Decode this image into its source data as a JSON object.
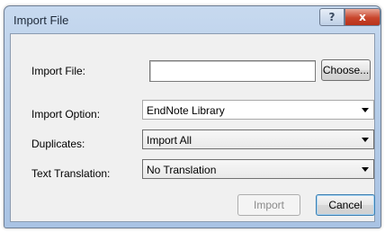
{
  "window": {
    "title": "Import File",
    "help_label": "?",
    "close_label": "x"
  },
  "form": {
    "import_file": {
      "label": "Import File:",
      "value": "",
      "choose_label": "Choose..."
    },
    "import_option": {
      "label": "Import Option:",
      "value": "EndNote Library"
    },
    "duplicates": {
      "label": "Duplicates:",
      "value": "Import All"
    },
    "text_translation": {
      "label": "Text Translation:",
      "value": "No Translation"
    }
  },
  "buttons": {
    "import_label": "Import",
    "import_enabled": false,
    "cancel_label": "Cancel"
  }
}
